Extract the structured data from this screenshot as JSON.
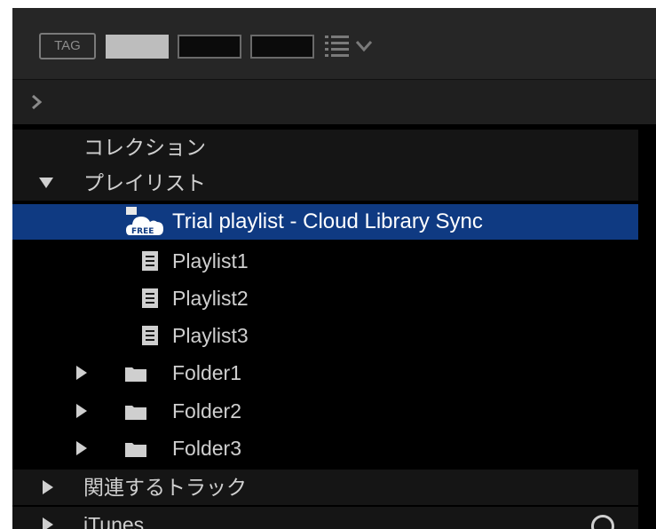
{
  "toolbar": {
    "tag_label": "TAG",
    "swatches": [
      "#bdbdbd",
      "#0b0b0b",
      "#0b0b0b"
    ],
    "view_icon": "list-view-icon",
    "menu_icon": "chevron-down-icon"
  },
  "filterbar": {
    "expand_icon": "chevron-right-icon"
  },
  "tree": {
    "collection": "コレクション",
    "playlists_header": "プレイリスト",
    "items": [
      {
        "label": "Trial playlist - Cloud Library Sync",
        "icon": "cloud-free-icon",
        "selected": true
      },
      {
        "label": "Playlist1",
        "icon": "playlist-icon"
      },
      {
        "label": "Playlist2",
        "icon": "playlist-icon"
      },
      {
        "label": "Playlist3",
        "icon": "playlist-icon"
      },
      {
        "label": "Folder1",
        "icon": "folder-icon"
      },
      {
        "label": "Folder2",
        "icon": "folder-icon"
      },
      {
        "label": "Folder3",
        "icon": "folder-icon"
      }
    ],
    "related_tracks": "関連するトラック",
    "itunes": "iTunes"
  },
  "colors": {
    "selection": "#0f3a82",
    "text": "#cfcfcf",
    "background": "#000000"
  }
}
